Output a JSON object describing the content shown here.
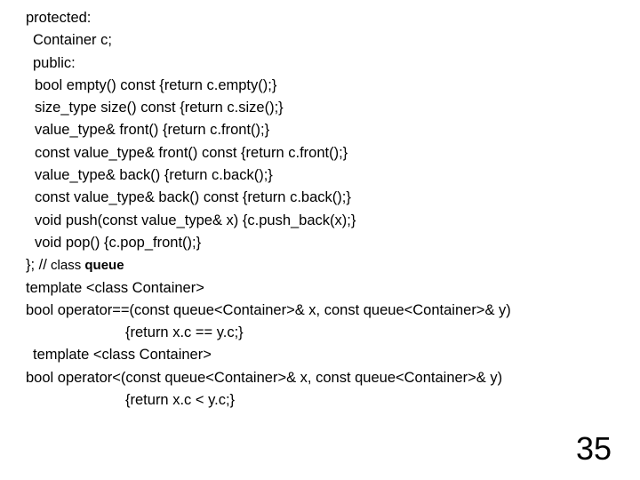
{
  "code": {
    "l01": "protected:",
    "l02": "Container c;",
    "l03": "public:",
    "l04": "bool empty() const {return c.empty();}",
    "l05": "size_type size() const {return c.size();}",
    "l06": "value_type& front() {return c.front();}",
    "l07": "const value_type& front() const {return c.front();}",
    "l08": "value_type& back() {return c.back();}",
    "l09": "const value_type& back() const {return c.back();}",
    "l10": "void push(const value_type& x) {c.push_back(x);}",
    "l11": "void pop() {c.pop_front();}",
    "l12a": "}; //",
    "l12b": " class ",
    "l12c": "queue",
    "l13": " ",
    "l14": "template <class Container>",
    "l15": "bool operator==(const queue<Container>& x, const queue<Container>& y)",
    "l16": "{return x.c == y.c;}",
    "l17": "template <class Container>",
    "l18": "bool operator<(const queue<Container>& x, const queue<Container>& y)",
    "l19": "{return x.c < y.c;}"
  },
  "page_number": "35"
}
